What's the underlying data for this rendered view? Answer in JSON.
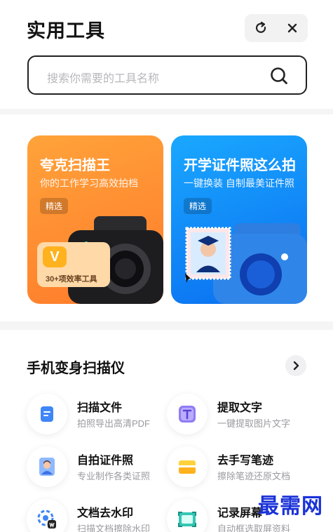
{
  "header": {
    "title": "实用工具",
    "refresh_icon": "refresh-icon",
    "close_icon": "close-icon"
  },
  "search": {
    "placeholder": "搜索你需要的工具名称",
    "icon": "search-icon"
  },
  "banners": [
    {
      "title": "夸克扫描王",
      "subtitle": "你的工作学习高效拍档",
      "tag": "精选",
      "badge_text": "30+项效率工具",
      "badge_icon_letter": "V",
      "color": "#ff8a2e"
    },
    {
      "title": "开学证件照这么拍",
      "subtitle": "一键换装 自制最美证件照",
      "tag": "精选",
      "color": "#0f86f5"
    }
  ],
  "section": {
    "title": "手机变身扫描仪",
    "more_icon": "chevron-right-icon",
    "tools": [
      {
        "name": "扫描文件",
        "desc": "拍照导出高清PDF",
        "icon": "scan-file-icon"
      },
      {
        "name": "提取文字",
        "desc": "一键提取图片文字",
        "icon": "text-extract-icon"
      },
      {
        "name": "自拍证件照",
        "desc": "专业制作各类证照",
        "icon": "id-photo-icon"
      },
      {
        "name": "去手写笔迹",
        "desc": "擦除笔迹还原文档",
        "icon": "eraser-icon"
      },
      {
        "name": "文档去水印",
        "desc": "扫描文档擦除水印",
        "icon": "watermark-remove-icon"
      },
      {
        "name": "记录屏幕",
        "desc": "自动框选取屏资料",
        "icon": "screen-record-icon"
      }
    ]
  },
  "watermark": "最需网"
}
